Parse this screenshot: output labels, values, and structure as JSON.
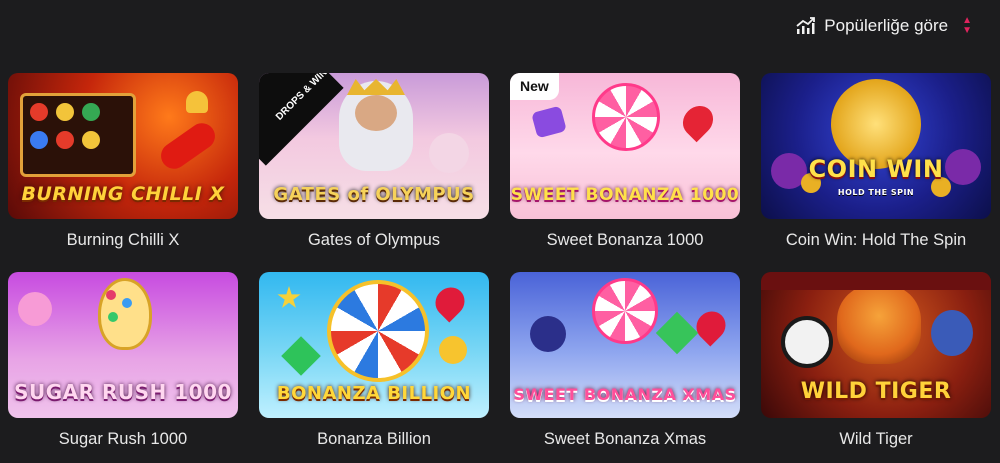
{
  "sort": {
    "label": "Popülerliğe göre",
    "icon": "trending-chart-icon",
    "caret_color": "#e0245e"
  },
  "games": [
    {
      "title": "Burning Chilli X",
      "logo": "BURNING CHILLI X"
    },
    {
      "title": "Gates of Olympus",
      "logo": "GATES of OLYMPUS",
      "ribbon": "DROPS & WINS"
    },
    {
      "title": "Sweet Bonanza 1000",
      "logo": "SWEET BONANZA 1000",
      "badge": "New"
    },
    {
      "title": "Coin Win: Hold The Spin",
      "logo": "COIN WIN",
      "sublogo": "HOLD THE SPIN"
    },
    {
      "title": "Sugar Rush 1000",
      "logo": "SUGAR RUSH 1000"
    },
    {
      "title": "Bonanza Billion",
      "logo": "BONANZA BILLION"
    },
    {
      "title": "Sweet Bonanza Xmas",
      "logo": "SWEET BONANZA XMAS"
    },
    {
      "title": "Wild Tiger",
      "logo": "WILD TIGER"
    }
  ]
}
